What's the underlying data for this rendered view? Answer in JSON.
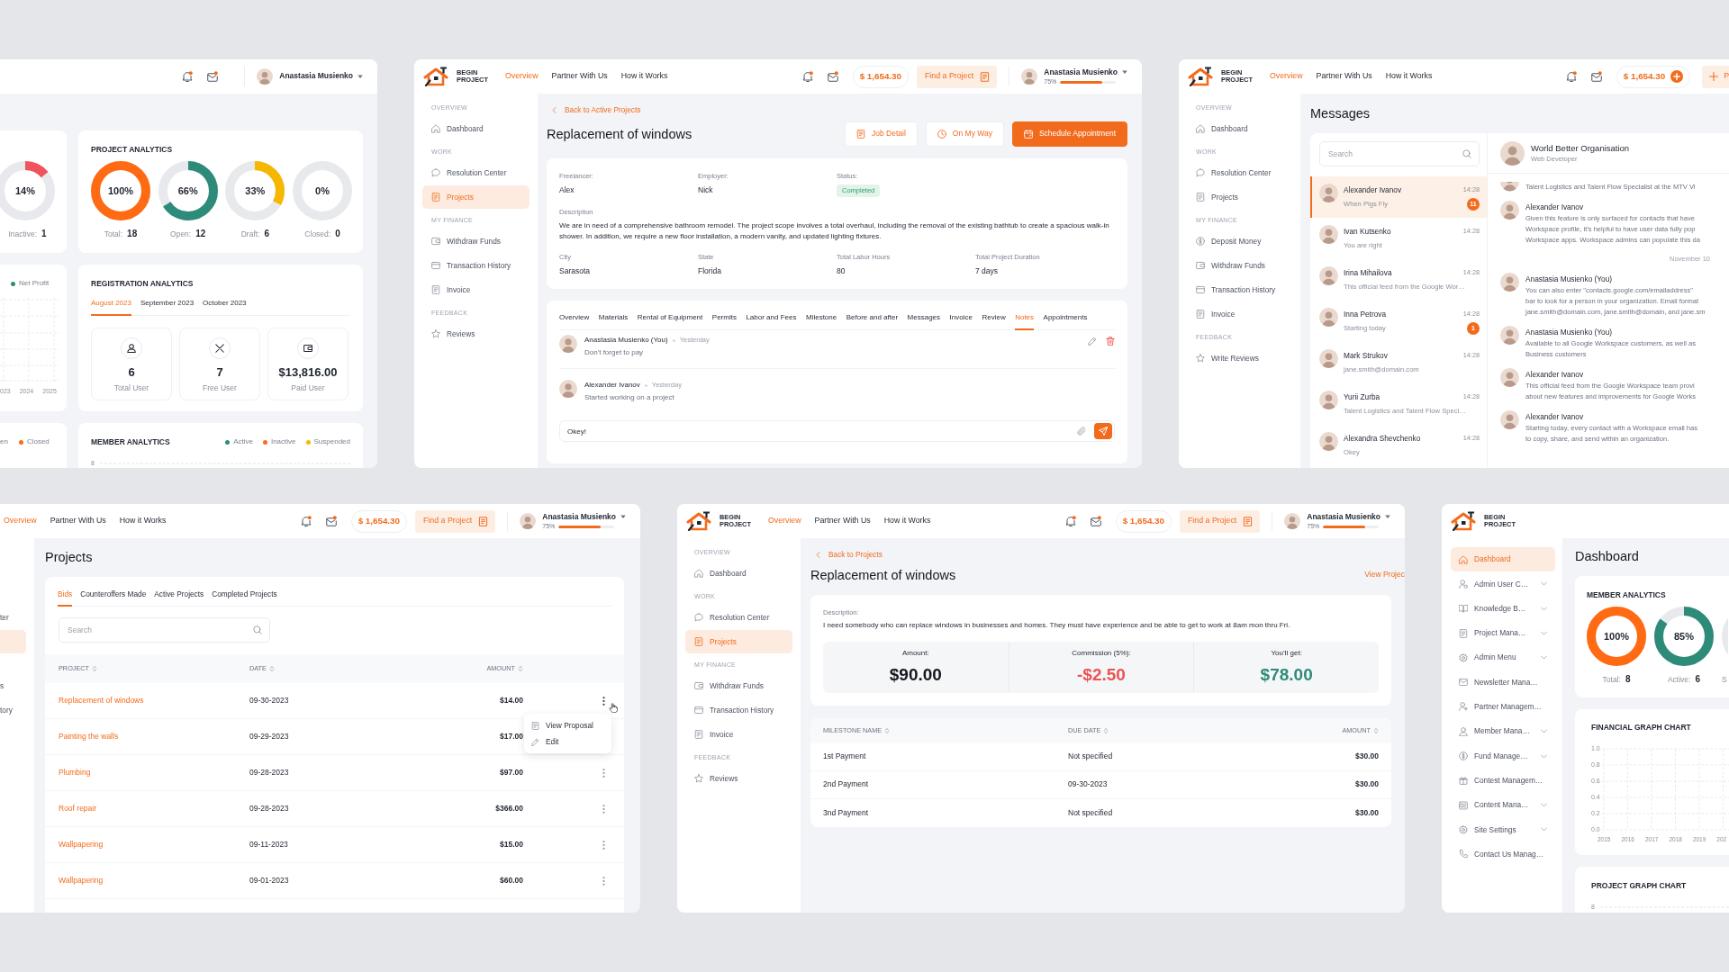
{
  "dashboard_panel": {
    "header": {
      "user": {
        "name": "Anastasia Musienko"
      }
    },
    "users_card": {
      "donuts": [
        {
          "percent": "14%",
          "level": 0.14,
          "color": "#f0525e",
          "label": "Inactive:",
          "value": "1"
        }
      ]
    },
    "project_analytics": {
      "title": "PROJECT ANALYTICS",
      "donuts": [
        {
          "percent": "100%",
          "level": 1,
          "color": "#ff6a13",
          "label": "Total:",
          "value": "18"
        },
        {
          "percent": "66%",
          "level": 0.66,
          "color": "#2e8b7a",
          "label": "Open:",
          "value": "12"
        },
        {
          "percent": "33%",
          "level": 0.33,
          "color": "#f5b700",
          "label": "Draft:",
          "value": "6"
        },
        {
          "percent": "0%",
          "label": "Closed:",
          "value": "0"
        }
      ]
    },
    "profit_card": {
      "legend": [
        {
          "label": "Net Profit",
          "color": "#2e8b7a"
        }
      ],
      "x_axis_labels": [
        "023",
        "2024",
        "2025"
      ]
    },
    "registration_analytics": {
      "title": "REGISTRATION ANALYTICS",
      "tabs": [
        {
          "label": "August 2023",
          "selected": true
        },
        {
          "label": "September 2023",
          "selected": false
        },
        {
          "label": "October 2023",
          "selected": false
        }
      ],
      "stats": [
        {
          "kind": "total",
          "value": "6",
          "label": "Total User"
        },
        {
          "kind": "free",
          "value": "7",
          "label": "Free User"
        },
        {
          "kind": "paid",
          "value": "$13,816.00",
          "label": "Paid User"
        }
      ]
    },
    "status_card": {
      "legend": [
        {
          "label": "en"
        },
        {
          "label": "Closed",
          "color": "#ff6a13"
        }
      ]
    },
    "member_analytics": {
      "title": "MEMBER ANALYTICS",
      "legend": [
        {
          "label": "Active",
          "color": "#2e8b7a"
        },
        {
          "label": "Inactive",
          "color": "#ff6a13"
        },
        {
          "label": "Suspended",
          "color": "#f5b700"
        }
      ],
      "y_axis_labels": [
        "8"
      ]
    }
  },
  "job_panel": {
    "header": {
      "logo_text": "BEGIN\nPROJECT",
      "nav": [
        {
          "label": "Overview",
          "selected": true
        },
        {
          "label": "Partner With Us",
          "selected": false
        },
        {
          "label": "How it Works",
          "selected": false
        }
      ],
      "balance": "$ 1,654.30",
      "find_button": "Find a Project",
      "user": {
        "name": "Anastasia Musienko",
        "progress_label": "75%",
        "level": 0.75
      }
    },
    "sidebar": {
      "sections": [
        {
          "title": "OVERVIEW",
          "items": [
            {
              "label": "Dashboard",
              "kind": "dashboard",
              "selected": false
            }
          ]
        },
        {
          "title": "WORK",
          "items": [
            {
              "label": "Resolution Center",
              "kind": "resolution",
              "selected": false
            },
            {
              "label": "Projects",
              "kind": "projects",
              "selected": true
            }
          ]
        },
        {
          "title": "MY FINANCE",
          "items": [
            {
              "label": "Withdraw Funds",
              "kind": "withdraw",
              "selected": false
            },
            {
              "label": "Transaction History",
              "kind": "transactions",
              "selected": false
            },
            {
              "label": "Invoice",
              "kind": "invoice",
              "selected": false
            }
          ]
        },
        {
          "title": "FEEDBACK",
          "items": [
            {
              "label": "Reviews",
              "kind": "reviews",
              "selected": false
            }
          ]
        }
      ]
    },
    "back_link": "Back to Active Projects",
    "title": "Replacement of windows",
    "actions": [
      {
        "label": "Job Detail",
        "primary": false
      },
      {
        "label": "On My Way",
        "primary": false
      },
      {
        "label": "Schedule Appointment",
        "primary": true
      }
    ],
    "details": {
      "fields": [
        {
          "label": "Freelancer:",
          "value": "Alex"
        },
        {
          "label": "Employer:",
          "value": "Nick"
        },
        {
          "label": "Status:",
          "value": "Completed",
          "kind": "badge"
        }
      ],
      "description_label": "Description",
      "description": "We are in need of a comprehensive bathroom remodel. The project scope involves a total overhaul, including the removal of the existing bathtub to create a spacious walk-in shower. In addition, we require a new floor installation, a modern vanity, and updated lighting fixtures.",
      "facts": [
        {
          "label": "City",
          "value": "Sarasota"
        },
        {
          "label": "State",
          "value": "Florida"
        },
        {
          "label": "Total Labor Hours",
          "value": "80"
        },
        {
          "label": "Total Project Duration",
          "value": "7 days"
        }
      ]
    },
    "tabs": [
      {
        "label": "Overview",
        "selected": false
      },
      {
        "label": "Materials",
        "selected": false
      },
      {
        "label": "Rental of Equipment",
        "selected": false
      },
      {
        "label": "Permits",
        "selected": false
      },
      {
        "label": "Labor and Fees",
        "selected": false
      },
      {
        "label": "Milestone",
        "selected": false
      },
      {
        "label": "Before and after",
        "selected": false
      },
      {
        "label": "Messages",
        "selected": false
      },
      {
        "label": "Invoice",
        "selected": false
      },
      {
        "label": "Review",
        "selected": false
      },
      {
        "label": "Notes",
        "selected": true
      },
      {
        "label": "Appointments",
        "selected": false
      }
    ],
    "notes": [
      {
        "author": "Anastasia Musienko (You)",
        "time": "Yesterday",
        "text": "Don't forget to pay",
        "editable": true
      },
      {
        "author": "Alexander Ivanov",
        "time": "Yesterday",
        "text": "Started working on a project",
        "editable": false
      }
    ],
    "composer": {
      "value": "Okey!"
    }
  },
  "messages_panel": {
    "header": {
      "logo_text": "BEGIN\nPROJECT",
      "nav": [
        {
          "label": "Overview",
          "selected": true
        },
        {
          "label": "Partner With Us",
          "selected": false
        },
        {
          "label": "How it Works",
          "selected": false
        }
      ],
      "balance": "$ 1,654.30",
      "add_funds": true,
      "add_button": "P"
    },
    "sidebar": {
      "sections": [
        {
          "title": "OVERVIEW",
          "items": [
            {
              "label": "Dashboard",
              "kind": "dashboard",
              "selected": false
            }
          ]
        },
        {
          "title": "WORK",
          "items": [
            {
              "label": "Resolution Center",
              "kind": "resolution",
              "selected": false
            },
            {
              "label": "Projects",
              "kind": "projects",
              "selected": false
            }
          ]
        },
        {
          "title": "MY FINANCE",
          "items": [
            {
              "label": "Deposit Money",
              "kind": "deposit",
              "selected": false
            },
            {
              "label": "Withdraw Funds",
              "kind": "withdraw",
              "selected": false
            },
            {
              "label": "Transaction History",
              "kind": "transactions",
              "selected": false
            },
            {
              "label": "Invoice",
              "kind": "invoice",
              "selected": false
            }
          ]
        },
        {
          "title": "FEEDBACK",
          "items": [
            {
              "label": "Write Reviews",
              "kind": "reviews",
              "selected": false
            }
          ]
        }
      ]
    },
    "title": "Messages",
    "search": {
      "placeholder": "Search"
    },
    "conversations": [
      {
        "name": "Alexander Ivanov",
        "time": "14:28",
        "preview": "When Pigs Fly",
        "unread": "11",
        "selected": true
      },
      {
        "name": "Ivan Kutsenko",
        "time": "14:28",
        "preview": "You are right",
        "selected": false
      },
      {
        "name": "Irina Mihailova",
        "time": "14:28",
        "preview": "This official feed from the Google Wor…",
        "selected": false
      },
      {
        "name": "Inna Petrova",
        "time": "14:28",
        "preview": "Starting today",
        "unread": "1",
        "selected": false
      },
      {
        "name": "Mark Strukov",
        "time": "14:28",
        "preview": "jane.smith@domain.com",
        "selected": false
      },
      {
        "name": "Yurii Zurba",
        "time": "14:28",
        "preview": "Talent Logistics and Talent Flow Speci…",
        "selected": false
      },
      {
        "name": "Alexandra Shevchenko",
        "time": "14:28",
        "preview": "Okey",
        "selected": false
      }
    ],
    "chat": {
      "contact": {
        "name": "World Better Organisation",
        "role": "Web Developer"
      },
      "messages": [
        {
          "kind": "message",
          "text": "Talent Logistics and Talent Flow Specialist at the MTV Vi"
        },
        {
          "kind": "message",
          "author": "Alexander Ivanov",
          "text": "Given this feature is only surfaced for contacts that have\nWorkspace profile, it’s helpful to have user data fully pop\nWorkspace apps. Workspace admins can populate this da"
        },
        {
          "kind": "date",
          "text": "November 10"
        },
        {
          "kind": "message",
          "author": "Anastasia Musienko (You)",
          "text": "You can also enter \"contacts.google.com/emailaddress\"\nbar to look for a person in your organization. Email format\njane.smith@domain.com, jane.smith@domain, and jane.sm"
        },
        {
          "kind": "message",
          "author": "Anastasia Musienko (You)",
          "text": "Available to all Google Workspace customers, as well as\nBusiness customers"
        },
        {
          "kind": "message",
          "author": "Alexander Ivanov",
          "text": "This official feed from the Google Workspace team provi\nabout new features and improvements for Google Works"
        },
        {
          "kind": "message",
          "author": "Alexander Ivanov",
          "text": "Starting today, every contact with a Workspace email has\nto copy, share, and send within an organization."
        }
      ]
    }
  },
  "projects_panel": {
    "header": {
      "nav": [
        {
          "label": "Overview",
          "selected": true
        },
        {
          "label": "Partner With Us",
          "selected": false
        },
        {
          "label": "How it Works",
          "selected": false
        }
      ],
      "balance": "$ 1,654.30",
      "find_button": "Find a Project",
      "user": {
        "name": "Anastasia Musienko",
        "progress_label": "75%",
        "level": 0.75
      }
    },
    "sidebar": {
      "sections": [
        {
          "items": [
            {
              "label": "ter",
              "selected": false
            },
            {
              "selected": true
            }
          ]
        },
        {
          "items": [
            {
              "label": "s",
              "selected": false
            },
            {
              "label": "tory",
              "selected": false
            }
          ]
        }
      ]
    },
    "title": "Projects",
    "tabs": [
      {
        "label": "Bids",
        "selected": true
      },
      {
        "label": "Counteroffers Made",
        "selected": false
      },
      {
        "label": "Active Projects",
        "selected": false
      },
      {
        "label": "Completed Projects",
        "selected": false
      }
    ],
    "search": {
      "placeholder": "Search"
    },
    "table": {
      "columns": [
        "PROJECT",
        "DATE",
        "AMOUNT"
      ],
      "rows": [
        {
          "project": "Replacement of windows",
          "date": "09-30-2023",
          "amount": "$14.00",
          "menu_open": true
        },
        {
          "project": "Painting the walls",
          "date": "09-29-2023",
          "amount": "$17.00",
          "menu_open": false
        },
        {
          "project": "Plumbing",
          "date": "09-28-2023",
          "amount": "$97.00",
          "menu_open": false
        },
        {
          "project": "Roof repair",
          "date": "09-28-2023",
          "amount": "$366.00",
          "menu_open": false
        },
        {
          "project": "Wallpapering",
          "date": "09-11-2023",
          "amount": "$15.00",
          "menu_open": false
        },
        {
          "project": "Wallpapering",
          "date": "09-01-2023",
          "amount": "$60.00",
          "menu_open": false
        }
      ]
    },
    "row_menu": [
      {
        "label": "View Proposal"
      },
      {
        "label": "Edit"
      }
    ]
  },
  "milestones_panel": {
    "header": {
      "logo_text": "BEGIN\nPROJECT",
      "nav": [
        {
          "label": "Overview",
          "selected": true
        },
        {
          "label": "Partner With Us",
          "selected": false
        },
        {
          "label": "How it Works",
          "selected": false
        }
      ],
      "balance": "$ 1,654.30",
      "find_button": "Find a Project",
      "user": {
        "name": "Anastasia Musienko",
        "progress_label": "75%",
        "level": 0.75
      }
    },
    "sidebar": {
      "sections": [
        {
          "title": "OVERVIEW",
          "items": [
            {
              "label": "Dashboard",
              "kind": "dashboard",
              "selected": false
            }
          ]
        },
        {
          "title": "WORK",
          "items": [
            {
              "label": "Resolution Center",
              "kind": "resolution",
              "selected": false
            },
            {
              "label": "Projects",
              "kind": "projects",
              "selected": true
            }
          ]
        },
        {
          "title": "MY FINANCE",
          "items": [
            {
              "label": "Withdraw Funds",
              "kind": "withdraw",
              "selected": false
            },
            {
              "label": "Transaction History",
              "kind": "transactions",
              "selected": false
            },
            {
              "label": "Invoice",
              "kind": "invoice",
              "selected": false
            }
          ]
        },
        {
          "title": "FEEDBACK",
          "items": [
            {
              "label": "Reviews",
              "kind": "reviews",
              "selected": false
            }
          ]
        }
      ]
    },
    "back_link": "Back to Projects",
    "title": "Replacement of windows",
    "view_link": "View Projec",
    "description_label": "Description:",
    "description": "I need somebody who can replace windows in businesses and homes. They must have experience and be able to get to work at 8am mon thru Fri.",
    "summary": [
      {
        "label": "Amount:",
        "value": "$90.00",
        "kind": "neutral"
      },
      {
        "label": "Commission (5%):",
        "value": "-$2.50",
        "kind": "negative"
      },
      {
        "label": "You’ll get:",
        "value": "$78.00",
        "kind": "positive"
      }
    ],
    "table": {
      "columns": [
        "MILESTONE NAME",
        "DUE DATE",
        "AMOUNT"
      ],
      "rows": [
        [
          "1st Payment",
          "Not specified",
          "$30.00"
        ],
        [
          "2nd Payment",
          "09-30-2023",
          "$30.00"
        ],
        [
          "3nd Payment",
          "Not specified",
          "$30.00"
        ]
      ]
    }
  },
  "admin_panel": {
    "header": {
      "logo_text": "BEGIN\nPROJECT"
    },
    "sidebar": {
      "items": [
        {
          "label": "Dashboard",
          "kind": "dashboard",
          "selected": true,
          "has_submenu": false
        },
        {
          "label": "Admin User C…",
          "kind": "admin-users",
          "selected": false,
          "has_submenu": true
        },
        {
          "label": "Knowledge B…",
          "kind": "knowledge",
          "selected": false,
          "has_submenu": true
        },
        {
          "label": "Project Mana…",
          "kind": "projects",
          "selected": false,
          "has_submenu": true
        },
        {
          "label": "Admin Menu",
          "kind": "admin-menu",
          "selected": false,
          "has_submenu": true
        },
        {
          "label": "Newsletter Mana…",
          "kind": "newsletter",
          "selected": false,
          "has_submenu": false
        },
        {
          "label": "Partner Managem…",
          "kind": "partners",
          "selected": false,
          "has_submenu": false
        },
        {
          "label": "Member Mana…",
          "kind": "members",
          "selected": false,
          "has_submenu": true
        },
        {
          "label": "Fund Manage…",
          "kind": "funds",
          "selected": false,
          "has_submenu": true
        },
        {
          "label": "Contest Managem…",
          "kind": "contests",
          "selected": false,
          "has_submenu": false
        },
        {
          "label": "Content Mana…",
          "kind": "content",
          "selected": false,
          "has_submenu": true
        },
        {
          "label": "Site Settings",
          "kind": "settings",
          "selected": false,
          "has_submenu": true
        },
        {
          "label": "Contact Us Manag…",
          "kind": "contact",
          "selected": false,
          "has_submenu": false
        }
      ]
    },
    "title": "Dashboard",
    "member_analytics": {
      "title": "MEMBER ANALYTICS",
      "donuts": [
        {
          "percent": "100%",
          "level": 1,
          "color": "#ff6a13",
          "label": "Total:",
          "value": "8"
        },
        {
          "percent": "85%",
          "level": 0.85,
          "color": "#2e8b7a",
          "label": "Active:",
          "value": "6"
        },
        {
          "label": "S"
        }
      ]
    },
    "financial_chart": {
      "title": "FINANCIAL GRAPH CHART",
      "y_axis_labels": [
        "1.0",
        "0.8",
        "0.6",
        "0.4",
        "0.2",
        "0.0"
      ],
      "x_axis_labels": [
        "2015",
        "2016",
        "2017",
        "2018",
        "2019",
        "202"
      ]
    },
    "project_chart": {
      "title": "PROJECT GRAPH CHART",
      "y_axis_labels": [
        "8"
      ]
    }
  }
}
